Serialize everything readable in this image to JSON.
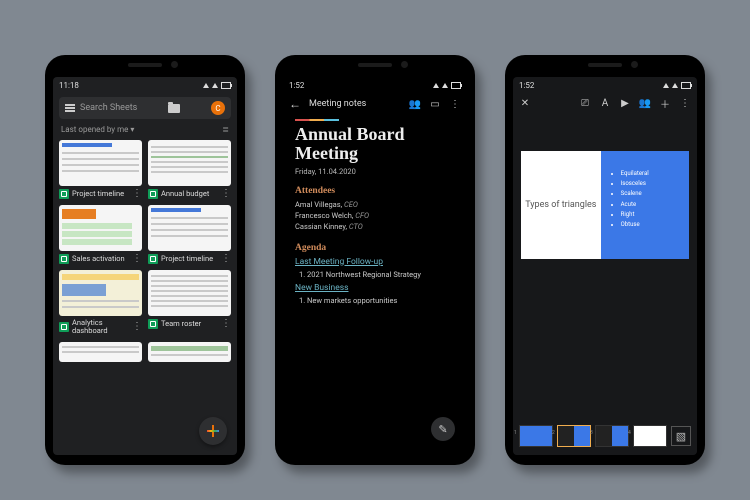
{
  "phone1": {
    "status_time": "11:18",
    "search_placeholder": "Search Sheets",
    "avatar_initial": "C",
    "sort_label": "Last opened by me",
    "files": [
      {
        "name": "Project timeline"
      },
      {
        "name": "Annual budget"
      },
      {
        "name": "Sales activation"
      },
      {
        "name": "Project timeline"
      },
      {
        "name": "Analytics dashboard"
      },
      {
        "name": "Team roster"
      }
    ]
  },
  "phone2": {
    "status_time": "1:52",
    "doc_title": "Meeting notes",
    "heading": "Annual Board Meeting",
    "date": "Friday, 11.04.2020",
    "attendees_label": "Attendees",
    "attendees": [
      {
        "name": "Amal Villegas",
        "role": "CEO"
      },
      {
        "name": "Francesco Welch",
        "role": "CFO"
      },
      {
        "name": "Cassian Kinney",
        "role": "CTO"
      }
    ],
    "agenda_label": "Agenda",
    "agenda_sub1": "Last Meeting Follow-up",
    "agenda_item1": "1.   2021 Northwest Regional Strategy",
    "agenda_sub2": "New Business",
    "agenda_item2": "1.   New markets opportunities"
  },
  "phone3": {
    "status_time": "1:52",
    "slide_title": "Types of triangles",
    "bullets": [
      "Equilateral",
      "Isosceles",
      "Scalene",
      "Acute",
      "Right",
      "Obtuse"
    ],
    "slide_numbers": [
      "1",
      "2",
      "3",
      "4"
    ]
  }
}
